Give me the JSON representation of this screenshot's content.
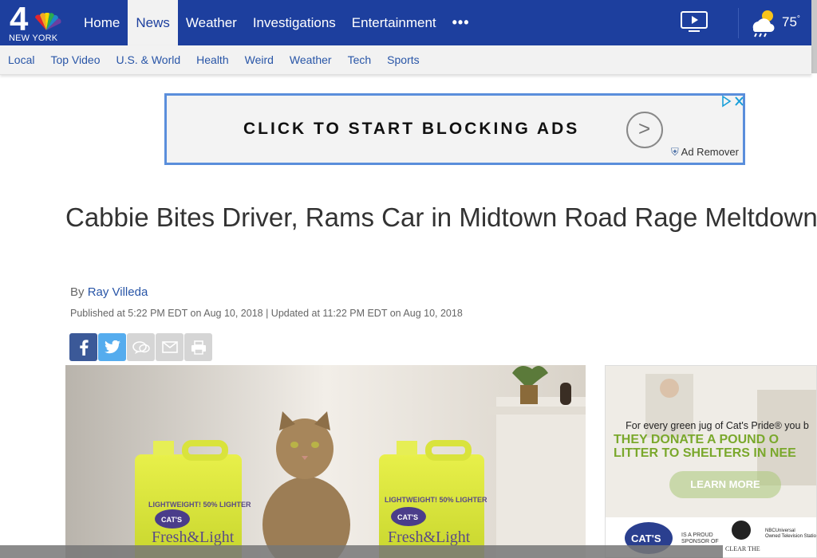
{
  "header": {
    "logo_number": "4",
    "logo_city": "NEW YORK",
    "nav": [
      "Home",
      "News",
      "Weather",
      "Investigations",
      "Entertainment"
    ],
    "nav_active": "News",
    "more_label": "•••",
    "temperature": "75",
    "temperature_unit": "°"
  },
  "subnav": [
    "Local",
    "Top Video",
    "U.S. & World",
    "Health",
    "Weird",
    "Weather",
    "Tech",
    "Sports"
  ],
  "ad": {
    "text": "CLICK TO START BLOCKING ADS",
    "remover": "Ad Remover"
  },
  "article": {
    "headline": "Cabbie Bites Driver, Rams Car in Midtown Road Rage Meltdown: Officials",
    "byline_prefix": "By",
    "author": "Ray Villeda",
    "published": "Published at 5:22 PM EDT on Aug 10, 2018 | Updated at 11:22 PM EDT on Aug 10, 2018"
  },
  "hero_ad": {
    "jug_label_top": "LIGHTWEIGHT! 50% LIGHTER",
    "brand": "CAT'S PRIDE",
    "product": "Fresh&Light"
  },
  "side_ad": {
    "copy": "For every green jug of Cat's Pride® you b",
    "big_line1": "THEY DONATE A POUND O",
    "big_line2": "LITTER TO SHELTERS IN NEE",
    "learn_more": "LEARN MORE",
    "sponsor_text": "IS A PROUD SPONSOR OF",
    "shelter": "CLEAR THE SHELTERS",
    "partner": "NBCUniversal Owned Television Stations"
  },
  "colors": {
    "nav_blue": "#1d3f9e",
    "link_blue": "#2855a7",
    "facebook": "#3b5998",
    "twitter": "#55acee"
  },
  "icons": {
    "share": [
      "facebook-icon",
      "twitter-icon",
      "comment-icon",
      "email-icon",
      "print-icon"
    ],
    "video": "video-play-icon",
    "weather": "partly-cloudy-rain-icon"
  }
}
